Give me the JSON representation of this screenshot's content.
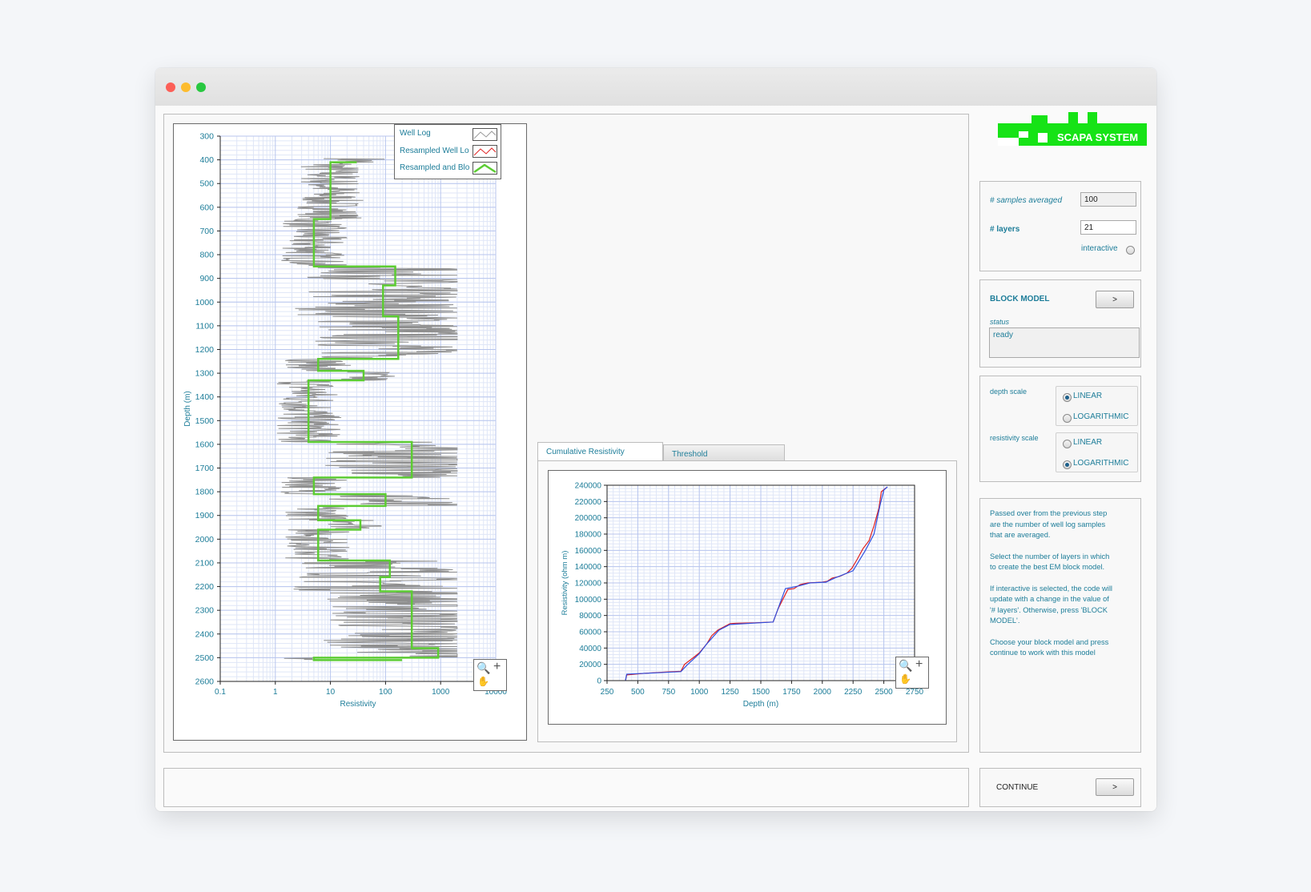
{
  "brand": {
    "name": "SCAPA SYSTEM",
    "color": "#16e316"
  },
  "params": {
    "samples_label": "# samples averaged",
    "samples_value": "100",
    "layers_label": "# layers",
    "layers_value": "21",
    "interactive_label": "interactive",
    "interactive_checked": false
  },
  "block": {
    "title": "BLOCK MODEL",
    "run_label": ">",
    "status_label": "status",
    "status_value": "ready"
  },
  "scales": {
    "depth_label": "depth scale",
    "resistivity_label": "resistivity scale",
    "linear": "LINEAR",
    "log": "LOGARITHMIC",
    "depth_selected": "LINEAR",
    "resistivity_selected": "LOGARITHMIC"
  },
  "help": [
    [
      "Passed over from the previous step",
      "are the number of well log samples",
      "that are averaged."
    ],
    [
      "Select the number of layers in which",
      "to create the best EM block model."
    ],
    [
      "If interactive is selected, the code will",
      "update with a change in the value of",
      "'# layers'. Otherwise, press 'BLOCK",
      "MODEL'."
    ],
    [
      "Choose your block model and press",
      "continue to work with this model"
    ]
  ],
  "footer": {
    "continue_label": "CONTINUE",
    "continue_button": ">"
  },
  "tabs": [
    "Cumulative Resistivity",
    "Threshold"
  ],
  "active_tab": "Cumulative Resistivity",
  "colors": {
    "accent": "#1d7d99",
    "raw_log": "#8f8f8f",
    "blocked": "#5ccc33",
    "resampled": "#e02020",
    "cumulative_block": "#3050e0"
  },
  "chart_data": [
    {
      "type": "line",
      "orientation": "depth-vertical",
      "xlabel": "Resistivity",
      "ylabel": "Depth (m)",
      "xscale": "log",
      "xlim": [
        0.1,
        10000
      ],
      "ylim": [
        300,
        2600
      ],
      "y_inverted": true,
      "x_ticks": [
        "0.1",
        "1",
        "10",
        "100",
        "1000",
        "10000"
      ],
      "y_ticks": [
        "300",
        "400",
        "500",
        "600",
        "700",
        "800",
        "900",
        "1000",
        "1100",
        "1200",
        "1300",
        "1400",
        "1500",
        "1600",
        "1700",
        "1800",
        "1900",
        "2000",
        "2100",
        "2200",
        "2300",
        "2400",
        "2500",
        "2600"
      ],
      "legend": [
        "Well Log",
        "Resampled Well Lo",
        "Resampled and Blo"
      ],
      "legend_position": "top-right",
      "grid": true,
      "series": [
        {
          "name": "Resampled and Blo",
          "step": true,
          "points": [
            [
              30,
              410
            ],
            [
              10,
              410
            ],
            [
              10,
              650
            ],
            [
              5,
              650
            ],
            [
              5,
              850
            ],
            [
              150,
              850
            ],
            [
              150,
              930
            ],
            [
              90,
              930
            ],
            [
              90,
              1060
            ],
            [
              170,
              1060
            ],
            [
              170,
              1240
            ],
            [
              6,
              1240
            ],
            [
              6,
              1290
            ],
            [
              40,
              1290
            ],
            [
              40,
              1330
            ],
            [
              4,
              1330
            ],
            [
              4,
              1590
            ],
            [
              300,
              1590
            ],
            [
              300,
              1740
            ],
            [
              5,
              1740
            ],
            [
              5,
              1810
            ],
            [
              100,
              1810
            ],
            [
              100,
              1860
            ],
            [
              6,
              1860
            ],
            [
              6,
              1920
            ],
            [
              35,
              1920
            ],
            [
              35,
              1960
            ],
            [
              6,
              1960
            ],
            [
              6,
              2090
            ],
            [
              120,
              2090
            ],
            [
              120,
              2160
            ],
            [
              80,
              2160
            ],
            [
              80,
              2220
            ],
            [
              300,
              2220
            ],
            [
              300,
              2460
            ],
            [
              900,
              2460
            ],
            [
              900,
              2500
            ],
            [
              5,
              2500
            ],
            [
              5,
              2510
            ],
            [
              200,
              2510
            ]
          ]
        }
      ]
    },
    {
      "type": "line",
      "xlabel": "Depth (m)",
      "ylabel": "Resistivity (ohm m)",
      "xlim": [
        250,
        2750
      ],
      "ylim": [
        0,
        240000
      ],
      "x_ticks": [
        "250",
        "500",
        "750",
        "1000",
        "1250",
        "1500",
        "1750",
        "2000",
        "2250",
        "2500",
        "2750"
      ],
      "y_ticks": [
        "0",
        "20000",
        "40000",
        "60000",
        "80000",
        "100000",
        "120000",
        "140000",
        "160000",
        "180000",
        "200000",
        "220000",
        "240000"
      ],
      "grid": true,
      "series": [
        {
          "name": "red",
          "points": [
            [
              400,
              0
            ],
            [
              410,
              7000
            ],
            [
              560,
              9000
            ],
            [
              720,
              10500
            ],
            [
              850,
              11500
            ],
            [
              880,
              20000
            ],
            [
              950,
              28000
            ],
            [
              1000,
              34000
            ],
            [
              1060,
              45000
            ],
            [
              1100,
              55000
            ],
            [
              1150,
              62000
            ],
            [
              1200,
              66000
            ],
            [
              1250,
              70000
            ],
            [
              1300,
              70500
            ],
            [
              1450,
              71000
            ],
            [
              1600,
              72000
            ],
            [
              1640,
              88000
            ],
            [
              1680,
              100000
            ],
            [
              1720,
              112000
            ],
            [
              1770,
              113000
            ],
            [
              1820,
              118000
            ],
            [
              1880,
              120000
            ],
            [
              2000,
              121000
            ],
            [
              2040,
              122000
            ],
            [
              2080,
              126000
            ],
            [
              2140,
              128000
            ],
            [
              2200,
              132000
            ],
            [
              2240,
              138000
            ],
            [
              2280,
              148000
            ],
            [
              2330,
              162000
            ],
            [
              2380,
              172000
            ],
            [
              2420,
              190000
            ],
            [
              2460,
              212000
            ],
            [
              2480,
              232000
            ],
            [
              2520,
              237000
            ]
          ]
        },
        {
          "name": "blue",
          "points": [
            [
              400,
              0
            ],
            [
              410,
              8000
            ],
            [
              850,
              11000
            ],
            [
              900,
              19000
            ],
            [
              1000,
              33000
            ],
            [
              1060,
              45000
            ],
            [
              1160,
              62000
            ],
            [
              1250,
              69000
            ],
            [
              1600,
              72000
            ],
            [
              1700,
              113000
            ],
            [
              1800,
              116000
            ],
            [
              1900,
              120000
            ],
            [
              2030,
              121000
            ],
            [
              2100,
              126000
            ],
            [
              2250,
              135000
            ],
            [
              2350,
              160000
            ],
            [
              2420,
              180000
            ],
            [
              2470,
              216000
            ],
            [
              2500,
              234000
            ],
            [
              2530,
              238000
            ]
          ]
        }
      ]
    }
  ]
}
